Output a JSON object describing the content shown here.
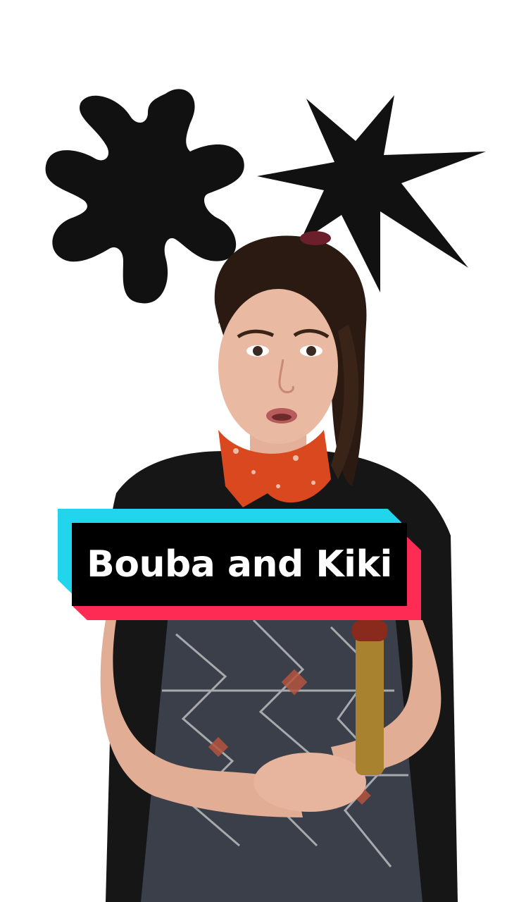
{
  "caption": {
    "text": "Bouba and Kiki"
  },
  "colors": {
    "background": "#ffffff",
    "shapes": "#111111",
    "caption_cyan": "#20d5ec",
    "caption_pink": "#fe2c55",
    "caption_black": "#000000",
    "caption_text": "#ffffff",
    "scarf": "#d9481f",
    "hair": "#2b1a12",
    "skin": "#e9b9a2",
    "shirt": "#111111"
  },
  "icons": [
    "bouba-shape-icon",
    "kiki-shape-icon"
  ]
}
